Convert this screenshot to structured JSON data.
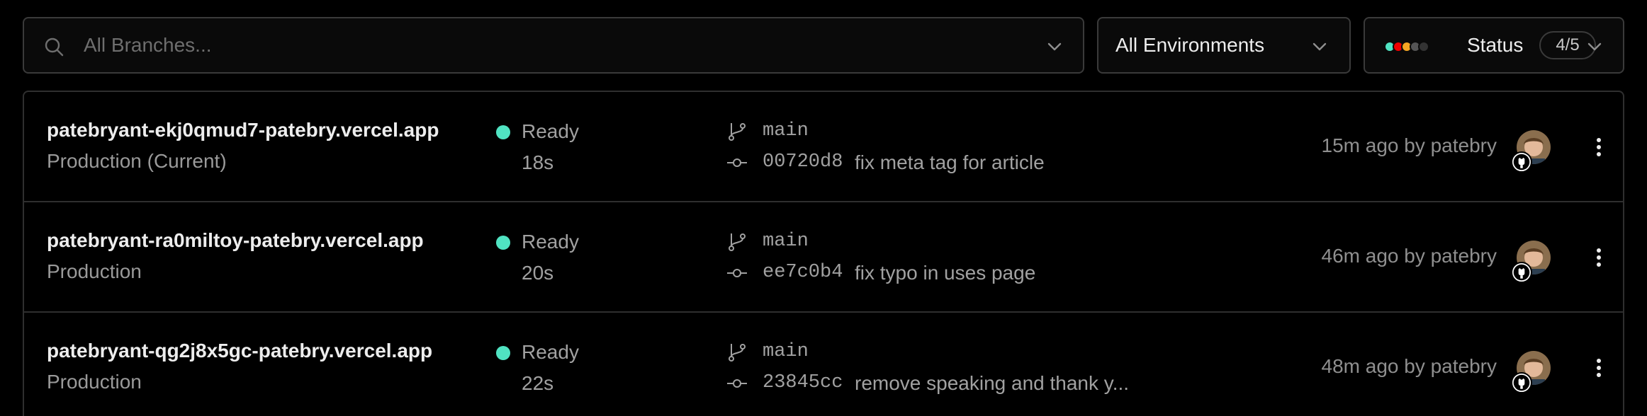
{
  "filters": {
    "branch_placeholder": "All Branches...",
    "environment_label": "All Environments",
    "status_label": "Status",
    "status_count": "4/5",
    "status_colors": [
      "#50e3c2",
      "#ee0000",
      "#f5a623",
      "#555555",
      "#333333"
    ]
  },
  "deployments": [
    {
      "url": "patebryant-ekj0qmud7-patebry.vercel.app",
      "environment": "Production (Current)",
      "status": "Ready",
      "duration": "18s",
      "branch": "main",
      "commit_hash": "00720d8",
      "commit_message": "fix meta tag for article",
      "time_by": "15m ago by patebry"
    },
    {
      "url": "patebryant-ra0miltoy-patebry.vercel.app",
      "environment": "Production",
      "status": "Ready",
      "duration": "20s",
      "branch": "main",
      "commit_hash": "ee7c0b4",
      "commit_message": "fix typo in uses page",
      "time_by": "46m ago by patebry"
    },
    {
      "url": "patebryant-qg2j8x5gc-patebry.vercel.app",
      "environment": "Production",
      "status": "Ready",
      "duration": "22s",
      "branch": "main",
      "commit_hash": "23845cc",
      "commit_message": "remove speaking and thank y...",
      "time_by": "48m ago by patebry"
    }
  ],
  "icons": {
    "search": "search-icon",
    "chevron": "chevron-down-icon",
    "branch": "git-branch-icon",
    "commit": "git-commit-icon",
    "github": "github-icon",
    "more": "more-vertical-icon"
  },
  "colors": {
    "ready": "#50e3c2",
    "background": "#000000",
    "border": "#2f2f2f"
  }
}
